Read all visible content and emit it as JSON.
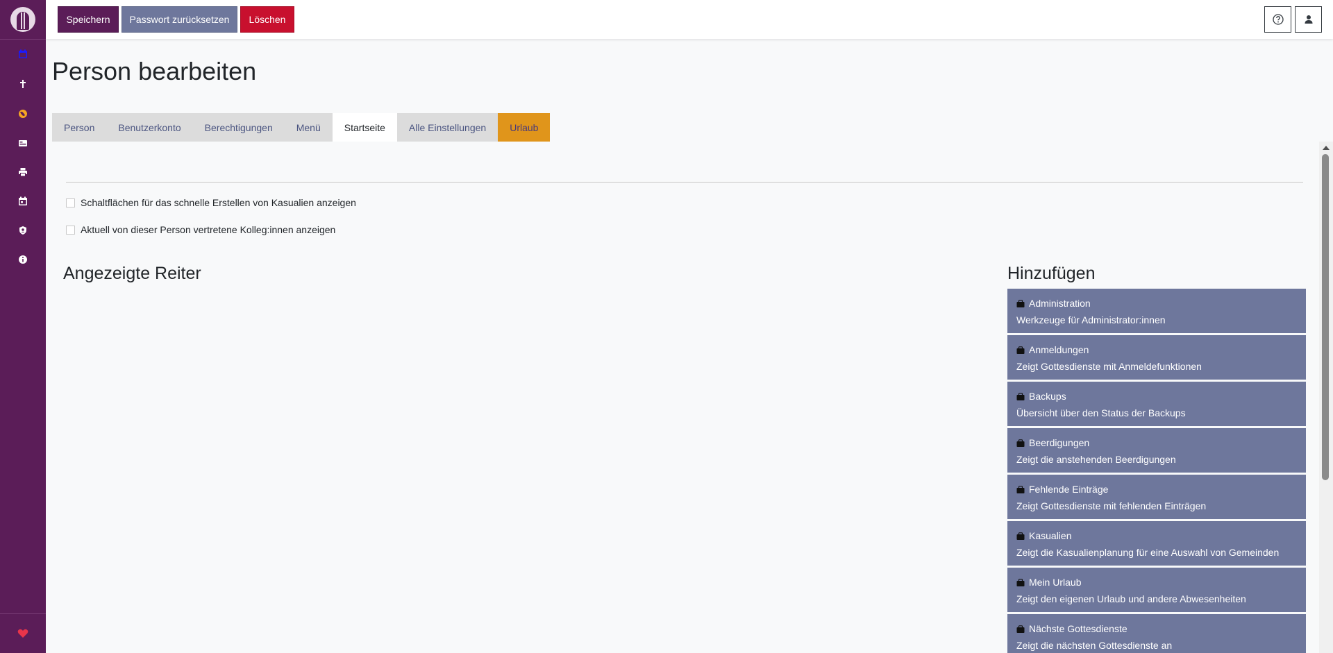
{
  "toolbar": {
    "save_label": "Speichern",
    "reset_password_label": "Passwort zurücksetzen",
    "delete_label": "Löschen"
  },
  "sidebar": {
    "items": [
      {
        "icon": "calendar-icon"
      },
      {
        "icon": "cross-icon"
      },
      {
        "icon": "globe-icon"
      },
      {
        "icon": "card-icon"
      },
      {
        "icon": "printer-icon"
      },
      {
        "icon": "calendar-check-icon"
      },
      {
        "icon": "shield-user-icon"
      },
      {
        "icon": "info-icon"
      }
    ],
    "footer_icon": "heart-icon"
  },
  "page": {
    "title": "Person bearbeiten"
  },
  "tabs": [
    {
      "label": "Person"
    },
    {
      "label": "Benutzerkonto"
    },
    {
      "label": "Berechtigungen"
    },
    {
      "label": "Menü"
    },
    {
      "label": "Startseite"
    },
    {
      "label": "Alle Einstellungen"
    },
    {
      "label": "Urlaub"
    }
  ],
  "active_tab": "Startseite",
  "options": [
    {
      "label": "Schaltflächen für das schnelle Erstellen von Kasualien anzeigen",
      "checked": false
    },
    {
      "label": "Aktuell von dieser Person vertretene Kolleg:innen anzeigen",
      "checked": false
    }
  ],
  "shown_tabs": {
    "heading": "Angezeigte Reiter"
  },
  "add": {
    "heading": "Hinzufügen",
    "items": [
      {
        "title": "Administration",
        "desc": "Werkzeuge für Administrator:innen"
      },
      {
        "title": "Anmeldungen",
        "desc": "Zeigt Gottesdienste mit Anmeldefunktionen"
      },
      {
        "title": "Backups",
        "desc": "Übersicht über den Status der Backups"
      },
      {
        "title": "Beerdigungen",
        "desc": "Zeigt die anstehenden Beerdigungen"
      },
      {
        "title": "Fehlende Einträge",
        "desc": "Zeigt Gottesdienste mit fehlenden Einträgen"
      },
      {
        "title": "Kasualien",
        "desc": "Zeigt die Kasualienplanung für eine Auswahl von Gemeinden"
      },
      {
        "title": "Mein Urlaub",
        "desc": "Zeigt den eigenen Urlaub und andere Abwesenheiten"
      },
      {
        "title": "Nächste Gottesdienste",
        "desc": "Zeigt die nächsten Gottesdienste an"
      }
    ]
  },
  "colors": {
    "sidebar": "#5b1d58",
    "save": "#5b1d58",
    "reset": "#6e779c",
    "delete": "#c8102e",
    "urlaub_tab": "#e0951b",
    "add_item": "#6e779c"
  }
}
